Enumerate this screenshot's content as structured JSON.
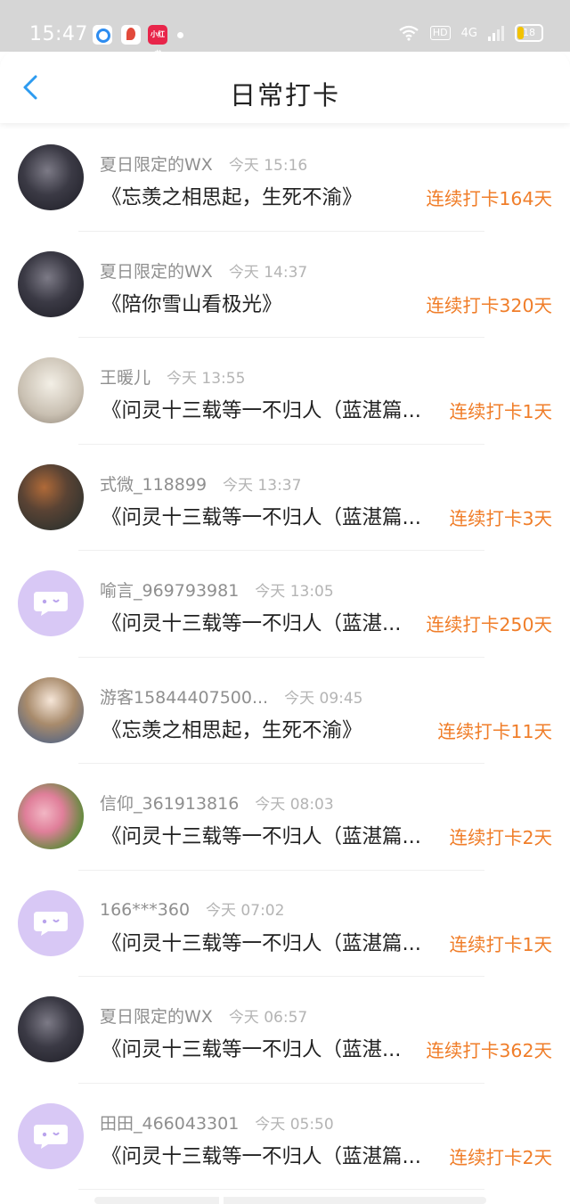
{
  "status_bar": {
    "time": "15:47",
    "app_icon_label": "小红书",
    "hd_label": "HD",
    "network_label": "4G",
    "battery": "18",
    "icons": [
      "wifi-icon",
      "signal-icon",
      "battery-icon"
    ]
  },
  "header": {
    "title": "日常打卡",
    "back_icon": "chevron-left-icon",
    "accent_color": "#2d9bf0"
  },
  "colors": {
    "streak": "#f07e2a",
    "default_avatar": "#d8c8f5"
  },
  "checkins": [
    {
      "user": "夏日限定的WX",
      "time": "今天 15:16",
      "title": "《忘羡之相思起，生死不渝》",
      "streak": "连续打卡164天",
      "avatar": "dark"
    },
    {
      "user": "夏日限定的WX",
      "time": "今天 14:37",
      "title": "《陪你雪山看极光》",
      "streak": "连续打卡320天",
      "avatar": "dark"
    },
    {
      "user": "王暖儿",
      "time": "今天 13:55",
      "title": "《问灵十三载等一不归人（蓝湛篇...",
      "streak": "连续打卡1天",
      "avatar": "light"
    },
    {
      "user": "式微_118899",
      "time": "今天 13:37",
      "title": "《问灵十三载等一不归人（蓝湛篇...",
      "streak": "连续打卡3天",
      "avatar": "room"
    },
    {
      "user": "喻言_969793981",
      "time": "今天 13:05",
      "title": "《问灵十三载等一不归人（蓝湛...",
      "streak": "连续打卡250天",
      "avatar": "default"
    },
    {
      "user": "游客15844407500...",
      "time": "今天 09:45",
      "title": "《忘羡之相思起，生死不渝》",
      "streak": "连续打卡11天",
      "avatar": "girl"
    },
    {
      "user": "信仰_361913816",
      "time": "今天 08:03",
      "title": "《问灵十三载等一不归人（蓝湛篇...",
      "streak": "连续打卡2天",
      "avatar": "flower"
    },
    {
      "user": "166***360",
      "time": "今天 07:02",
      "title": "《问灵十三载等一不归人（蓝湛篇...",
      "streak": "连续打卡1天",
      "avatar": "default"
    },
    {
      "user": "夏日限定的WX",
      "time": "今天 06:57",
      "title": "《问灵十三载等一不归人（蓝湛...",
      "streak": "连续打卡362天",
      "avatar": "dark"
    },
    {
      "user": "田田_466043301",
      "time": "今天 05:50",
      "title": "《问灵十三载等一不归人（蓝湛篇...",
      "streak": "连续打卡2天",
      "avatar": "default"
    }
  ]
}
